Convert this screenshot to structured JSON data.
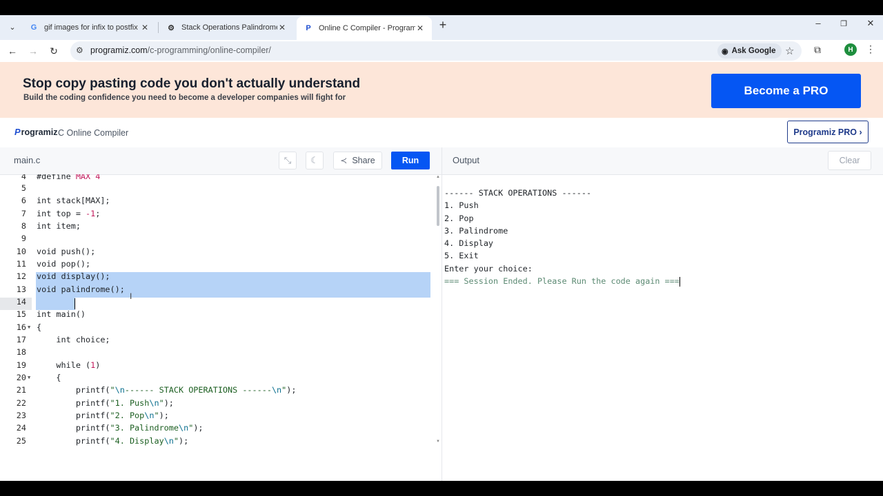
{
  "browser": {
    "tabs": [
      {
        "title": "gif images for infix to postfix ex",
        "favicon": "google-g-icon"
      },
      {
        "title": "Stack Operations Palindrome",
        "favicon": "chatgpt-icon"
      },
      {
        "title": "Online C Compiler - Programiz",
        "favicon": "programiz-icon",
        "active": true
      }
    ],
    "url_host": "programiz.com",
    "url_path": "/c-programming/online-compiler/",
    "ask_google": "Ask Google",
    "profile_initial": "H"
  },
  "promo": {
    "headline": "Stop copy pasting code you don't actually understand",
    "subtext": "Build the coding confidence you need to become a developer companies will fight for",
    "cta": "Become a PRO"
  },
  "header": {
    "logo_text": "rogramiz",
    "page_heading": "C Online Compiler",
    "pro_button": "Programiz PRO ›"
  },
  "editor": {
    "filename": "main.c",
    "share_label": "Share",
    "run_label": "Run"
  },
  "output": {
    "title": "Output",
    "clear_label": "Clear",
    "lines": [
      "------ STACK OPERATIONS ------",
      "1. Push",
      "2. Pop",
      "3. Palindrome",
      "4. Display",
      "5. Exit",
      "Enter your choice:"
    ],
    "ended_line": "=== Session Ended. Please Run the code again ==="
  },
  "colors": {
    "brand_blue": "#0556f3",
    "promo_bg": "#fde6d9",
    "selection": "#b6d3f7"
  }
}
